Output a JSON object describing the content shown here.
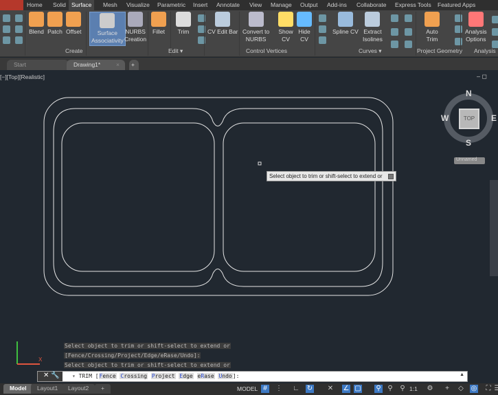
{
  "ribbon_tabs": [
    "Home",
    "Solid",
    "Surface",
    "Mesh",
    "Visualize",
    "Parametric",
    "Insert",
    "Annotate",
    "View",
    "Manage",
    "Output",
    "Add-ins",
    "Collaborate",
    "Express Tools",
    "Featured Apps"
  ],
  "active_tab": "Surface",
  "tools": {
    "blend": "Blend",
    "patch": "Patch",
    "offset": "Offset",
    "surface_assoc": [
      "Surface",
      "Associativity"
    ],
    "nurbs": [
      "NURBS",
      "Creation"
    ],
    "fillet": "Fillet",
    "trim": "Trim",
    "cv_edit_bar": "CV Edit Bar",
    "convert": [
      "Convert to",
      "NURBS"
    ],
    "show_cv": [
      "Show",
      "CV"
    ],
    "hide_cv": [
      "Hide",
      "CV"
    ],
    "spline_cv": "Spline CV",
    "extract": [
      "Extract",
      "Isolines"
    ],
    "auto_trim": [
      "Auto",
      "Trim"
    ],
    "analysis": [
      "Analysis",
      "Options"
    ]
  },
  "panels": {
    "create": "Create",
    "edit": "Edit ▾",
    "control_vertices": "Control Vertices",
    "curves": "Curves ▾",
    "project_geometry": "Project Geometry",
    "analysis": "Analysis"
  },
  "doc_tabs": [
    "Start",
    "Drawing1*"
  ],
  "viewport_label": "[−][Top][Realistic]",
  "viewcube": {
    "n": "N",
    "s": "S",
    "e": "E",
    "w": "W",
    "face": "TOP",
    "ucs": "Unnamed"
  },
  "tooltip": "Select object to trim or shift-select to extend or",
  "history": [
    "Select object to trim or shift-select to extend or",
    "[Fence/Crossing/Project/Edge/eRase/Undo]:",
    "Select object to trim or shift-select to extend or"
  ],
  "command": {
    "name": "TRIM",
    "options": [
      [
        "F",
        "ence"
      ],
      [
        "C",
        "rossing"
      ],
      [
        "P",
        "roject"
      ],
      [
        "E",
        "dge"
      ],
      [
        "e",
        "R",
        "ase"
      ],
      [
        "U",
        "ndo"
      ]
    ]
  },
  "layout_tabs": [
    "Model",
    "Layout1",
    "Layout2"
  ],
  "status": {
    "model": "MODEL",
    "scale": "1:1"
  },
  "colors": {
    "canvas": "#212830",
    "ribbon": "#454545",
    "accent": "#3d79c4",
    "app": "#b5382b"
  }
}
